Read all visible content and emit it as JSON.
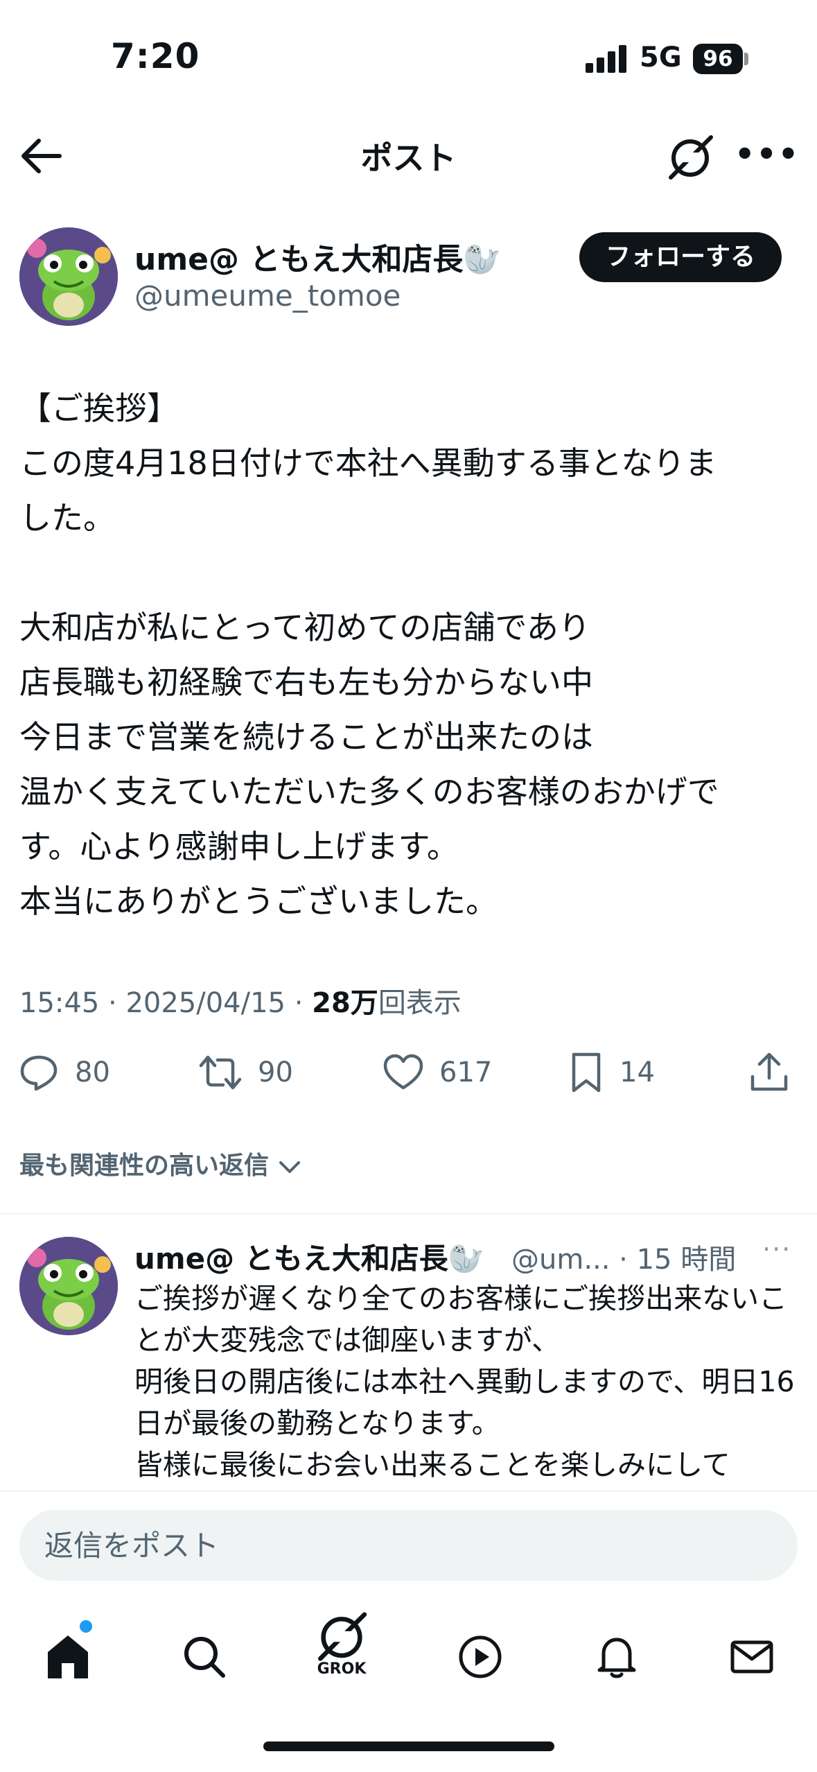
{
  "status_bar": {
    "time": "7:20",
    "network": "5G",
    "battery": "96"
  },
  "header": {
    "title": "ポスト"
  },
  "post": {
    "author_name": "ume@ ともえ大和店長🦭",
    "author_handle": "@umeume_tomoe",
    "follow_label": "フォローする",
    "body_lines": [
      "【ご挨拶】",
      "この度4月18日付けで本社へ異動する事となりま",
      "した。",
      "",
      "大和店が私にとって初めての店舗であり",
      "店長職も初経験で右も左も分からない中",
      "今日まで営業を続けることが出来たのは",
      "温かく支えていただいた多くのお客様のおかげで",
      "す。心より感謝申し上げます。",
      "本当にありがとうございました。"
    ],
    "time": "15:45",
    "date": "2025/04/15",
    "views_count": "28万",
    "views_label": "回表示",
    "replies": "80",
    "reposts": "90",
    "likes": "617",
    "bookmarks": "14"
  },
  "sort_label": "最も関連性の高い返信",
  "reply": {
    "author_name": "ume@ ともえ大和店長🦭",
    "handle_time": "@um... · 15 時間",
    "more": "···",
    "body": "ご挨拶が遅くなり全てのお客様にご挨拶出来ないことが大変残念では御座いますが、\n明後日の開店後には本社へ異動しますので、明日16日が最後の勤務となります。\n皆様に最後にお会い出来ることを楽しみにして"
  },
  "composer": {
    "placeholder": "返信をポスト"
  },
  "tabs": {
    "grok_label": "GROK"
  },
  "colors": {
    "accent": "#1d9bf0",
    "text": "#0f1419",
    "secondary": "#536471"
  }
}
